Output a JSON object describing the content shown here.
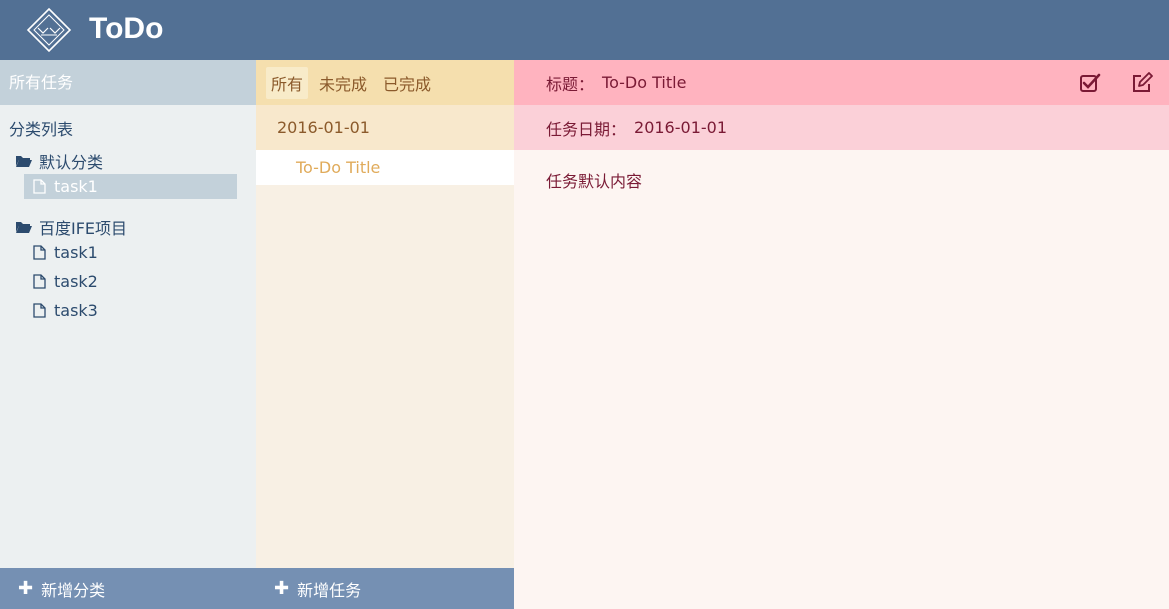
{
  "app": {
    "title": "ToDo"
  },
  "categories": {
    "header": "所有任务",
    "list_title": "分类列表",
    "groups": [
      {
        "name": "默认分类",
        "tasks": [
          "task1"
        ]
      },
      {
        "name": "百度IFE项目",
        "tasks": [
          "task1",
          "task2",
          "task3"
        ]
      }
    ],
    "add_label": "新增分类"
  },
  "tasks": {
    "tabs": [
      "所有",
      "未完成",
      "已完成"
    ],
    "active_tab": "所有",
    "date_group": "2016-01-01",
    "items": [
      "To-Do Title"
    ],
    "add_label": "新增任务"
  },
  "detail": {
    "title_label": "标题：",
    "title_value": "To-Do Title",
    "date_label": "任务日期：",
    "date_value": "2016-01-01",
    "content": "任务默认内容"
  },
  "colors": {
    "header": "#527094",
    "sidebar": "#ecf0f1",
    "tasks_header": "#f5dfae",
    "detail_header": "#ffb3bf",
    "footer": "#7590b3"
  },
  "icons": [
    "logo-icon",
    "folder-open-icon",
    "file-icon",
    "complete-check-icon",
    "edit-icon",
    "plus-icon"
  ]
}
